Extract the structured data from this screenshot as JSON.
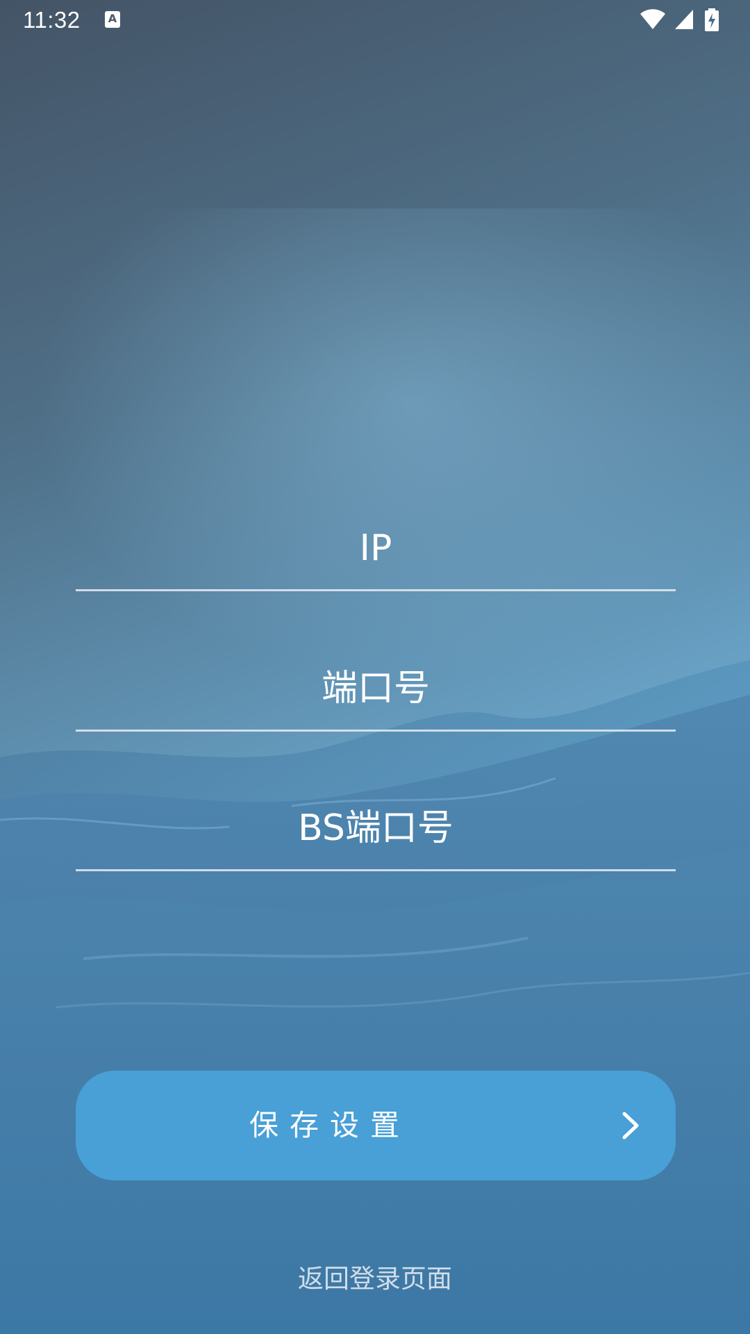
{
  "status_bar": {
    "time": "11:32",
    "notification_icon": "a-icon",
    "icons": [
      "wifi-icon",
      "signal-icon",
      "battery-charging-icon"
    ]
  },
  "form": {
    "ip": {
      "placeholder": "IP",
      "value": ""
    },
    "port": {
      "placeholder": "端口号",
      "value": ""
    },
    "bs_port": {
      "placeholder": "BS端口号",
      "value": ""
    }
  },
  "save_button": {
    "label": "保存设置",
    "icon": "chevron-right-icon",
    "color": "#48a0d6"
  },
  "back_link": {
    "label": "返回登录页面"
  }
}
